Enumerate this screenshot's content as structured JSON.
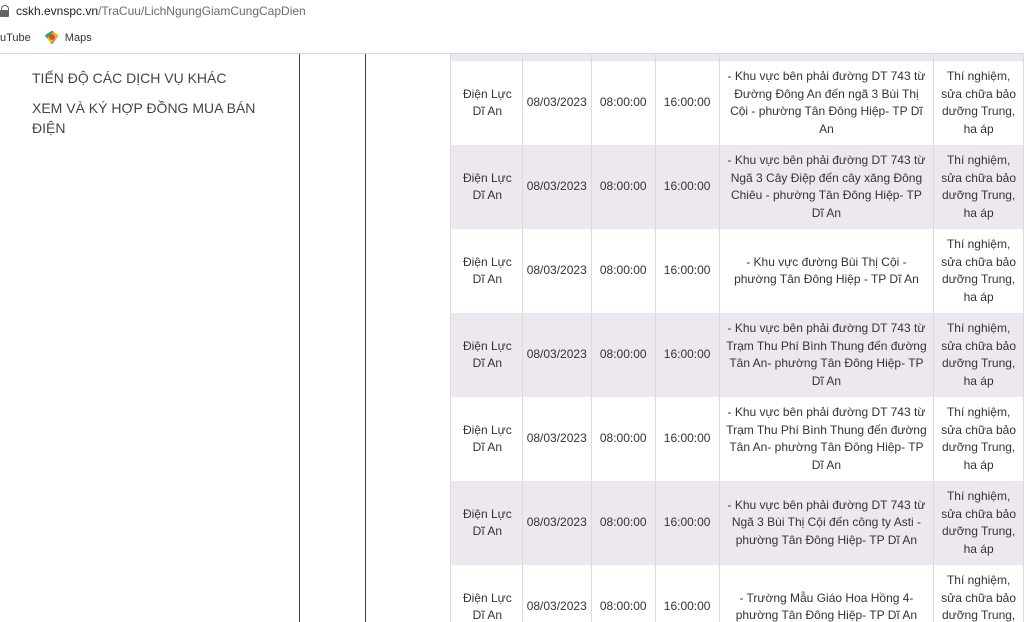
{
  "browser": {
    "url_host": "cskh.evnspc.vn",
    "url_path": "/TraCuu/LichNgungGiamCungCapDien",
    "bookmarks": [
      {
        "label": "uTube",
        "icon": "youtube-icon"
      },
      {
        "label": "Maps",
        "icon": "maps-icon"
      }
    ]
  },
  "menu": {
    "items": [
      "TIẾN ĐỘ CÁC DỊCH VỤ KHÁC",
      "XEM VÀ KÝ HỢP ĐỒNG MUA BÁN ĐIỆN"
    ]
  },
  "table": {
    "rows": [
      {
        "unit": "Điện Lực Dĩ An",
        "date": "08/03/2023",
        "start": "08:00:00",
        "end": "16:00:00",
        "area": "- Khu vực bên phải đường DT 743 từ Đường Đông An đến ngã 3 Bùi Thị Cội - phường Tân Đông Hiệp- TP Dĩ An",
        "reason": "Thí nghiệm, sửa chữa bảo dưỡng Trung, ha áp"
      },
      {
        "unit": "Điện Lực Dĩ An",
        "date": "08/03/2023",
        "start": "08:00:00",
        "end": "16:00:00",
        "area": "- Khu vực bên phải đường DT 743 từ Ngã 3 Cây Điệp đến cây xăng Đông Chiêu - phường Tân Đông Hiệp- TP Dĩ An",
        "reason": "Thí nghiệm, sửa chữa bảo dưỡng Trung, ha áp"
      },
      {
        "unit": "Điện Lực Dĩ An",
        "date": "08/03/2023",
        "start": "08:00:00",
        "end": "16:00:00",
        "area": "- Khu vực đường Bùi Thị Cội - phường Tân Đông Hiệp - TP Dĩ An",
        "reason": "Thí nghiệm, sửa chữa bảo dưỡng Trung, ha áp"
      },
      {
        "unit": "Điện Lực Dĩ An",
        "date": "08/03/2023",
        "start": "08:00:00",
        "end": "16:00:00",
        "area": "- Khu vực bên phải đường DT 743 từ Trạm Thu Phí Bình Thung đến đường Tân An- phường Tân Đông Hiệp- TP Dĩ An",
        "reason": "Thí nghiệm, sửa chữa bảo dưỡng Trung, ha áp"
      },
      {
        "unit": "Điện Lực Dĩ An",
        "date": "08/03/2023",
        "start": "08:00:00",
        "end": "16:00:00",
        "area": "- Khu vực bên phải đường DT 743 từ Trạm Thu Phí Bình Thung đến đường Tân An- phường Tân Đông Hiệp- TP Dĩ An",
        "reason": "Thí nghiệm, sửa chữa bảo dưỡng Trung, ha áp"
      },
      {
        "unit": "Điện Lực Dĩ An",
        "date": "08/03/2023",
        "start": "08:00:00",
        "end": "16:00:00",
        "area": "- Khu vực bên phải đường DT 743 từ Ngã 3 Bùi Thị Cội đến công ty Asti - phường Tân Đông Hiệp- TP Dĩ An",
        "reason": "Thí nghiệm, sửa chữa bảo dưỡng Trung, ha áp"
      },
      {
        "unit": "Điện Lực Dĩ An",
        "date": "08/03/2023",
        "start": "08:00:00",
        "end": "16:00:00",
        "area": "- Trường Mẫu Giáo Hoa Hồng 4- phường Tân Đông Hiệp- TP Dĩ An",
        "reason": "Thí nghiệm, sửa chữa bảo dưỡng Trung, ha áp"
      }
    ]
  }
}
